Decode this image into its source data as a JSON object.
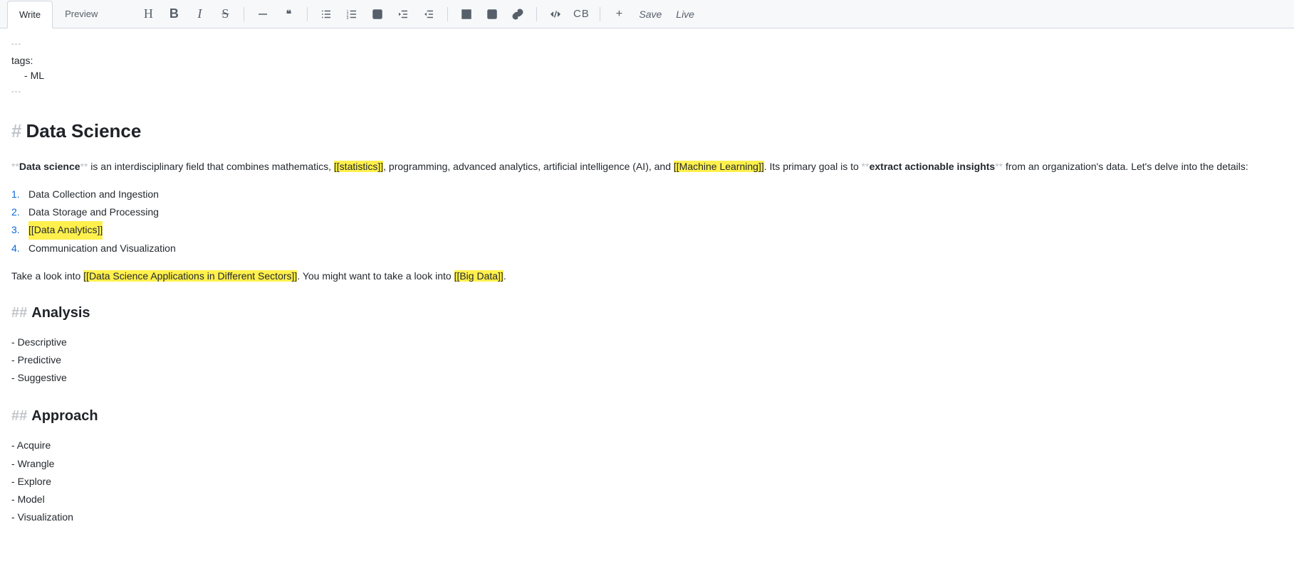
{
  "tabs": {
    "write": "Write",
    "preview": "Preview"
  },
  "toolbar": {
    "heading_tip": "Heading",
    "bold_tip": "Bold",
    "italic_tip": "Italic",
    "strike_tip": "Strikethrough",
    "hr_tip": "Horizontal rule",
    "quote_glyph": "❝",
    "ul_tip": "Bulleted list",
    "ol_tip": "Numbered list",
    "task_tip": "Task list",
    "indent_tip": "Indent",
    "outdent_tip": "Outdent",
    "table_tip": "Table",
    "image_tip": "Image",
    "link_tip": "Link",
    "code_tip": "Code",
    "codeblock_label": "CB",
    "plus_glyph": "+",
    "save": "Save",
    "live": "Live"
  },
  "frontmatter": {
    "dash": "---",
    "tags_label": "tags:",
    "tags": [
      "ML"
    ]
  },
  "h1": {
    "mark": "#",
    "text": "Data Science"
  },
  "para1": {
    "pre_bold_mark": "**",
    "bold": "Data science",
    "post_bold_mark": "**",
    "seg1": " is an interdisciplinary field that combines mathematics, ",
    "link1": "[[statistics]]",
    "seg2": ", programming, advanced analytics, artificial intelligence (AI), and ",
    "link2": "[[Machine Learning]]",
    "seg3": ". Its primary goal is to ",
    "pre_bold2_mark": "**",
    "bold2": "extract actionable insights",
    "post_bold2_mark": "**",
    "seg4": " from an organization's data. Let's delve into the details:"
  },
  "olist": [
    {
      "n": "1.",
      "text": "Data Collection and Ingestion",
      "hl": false
    },
    {
      "n": "2.",
      "text": "Data Storage and Processing",
      "hl": false
    },
    {
      "n": "3.",
      "text": "[[Data Analytics]]",
      "hl": true
    },
    {
      "n": "4.",
      "text": "Communication and Visualization",
      "hl": false
    }
  ],
  "para2": {
    "seg1": "Take a look into ",
    "link1": "[[Data Science Applications in Different Sectors]]",
    "seg2": ". You might want to take a look into ",
    "link2": "[[Big Data]]",
    "seg3": "."
  },
  "h2a": {
    "mark": "##",
    "text": "Analysis"
  },
  "list_a": [
    "Descriptive",
    "Predictive",
    "Suggestive"
  ],
  "h2b": {
    "mark": "##",
    "text": "Approach"
  },
  "list_b": [
    "Acquire",
    "Wrangle",
    "Explore",
    "Model",
    "Visualization"
  ]
}
